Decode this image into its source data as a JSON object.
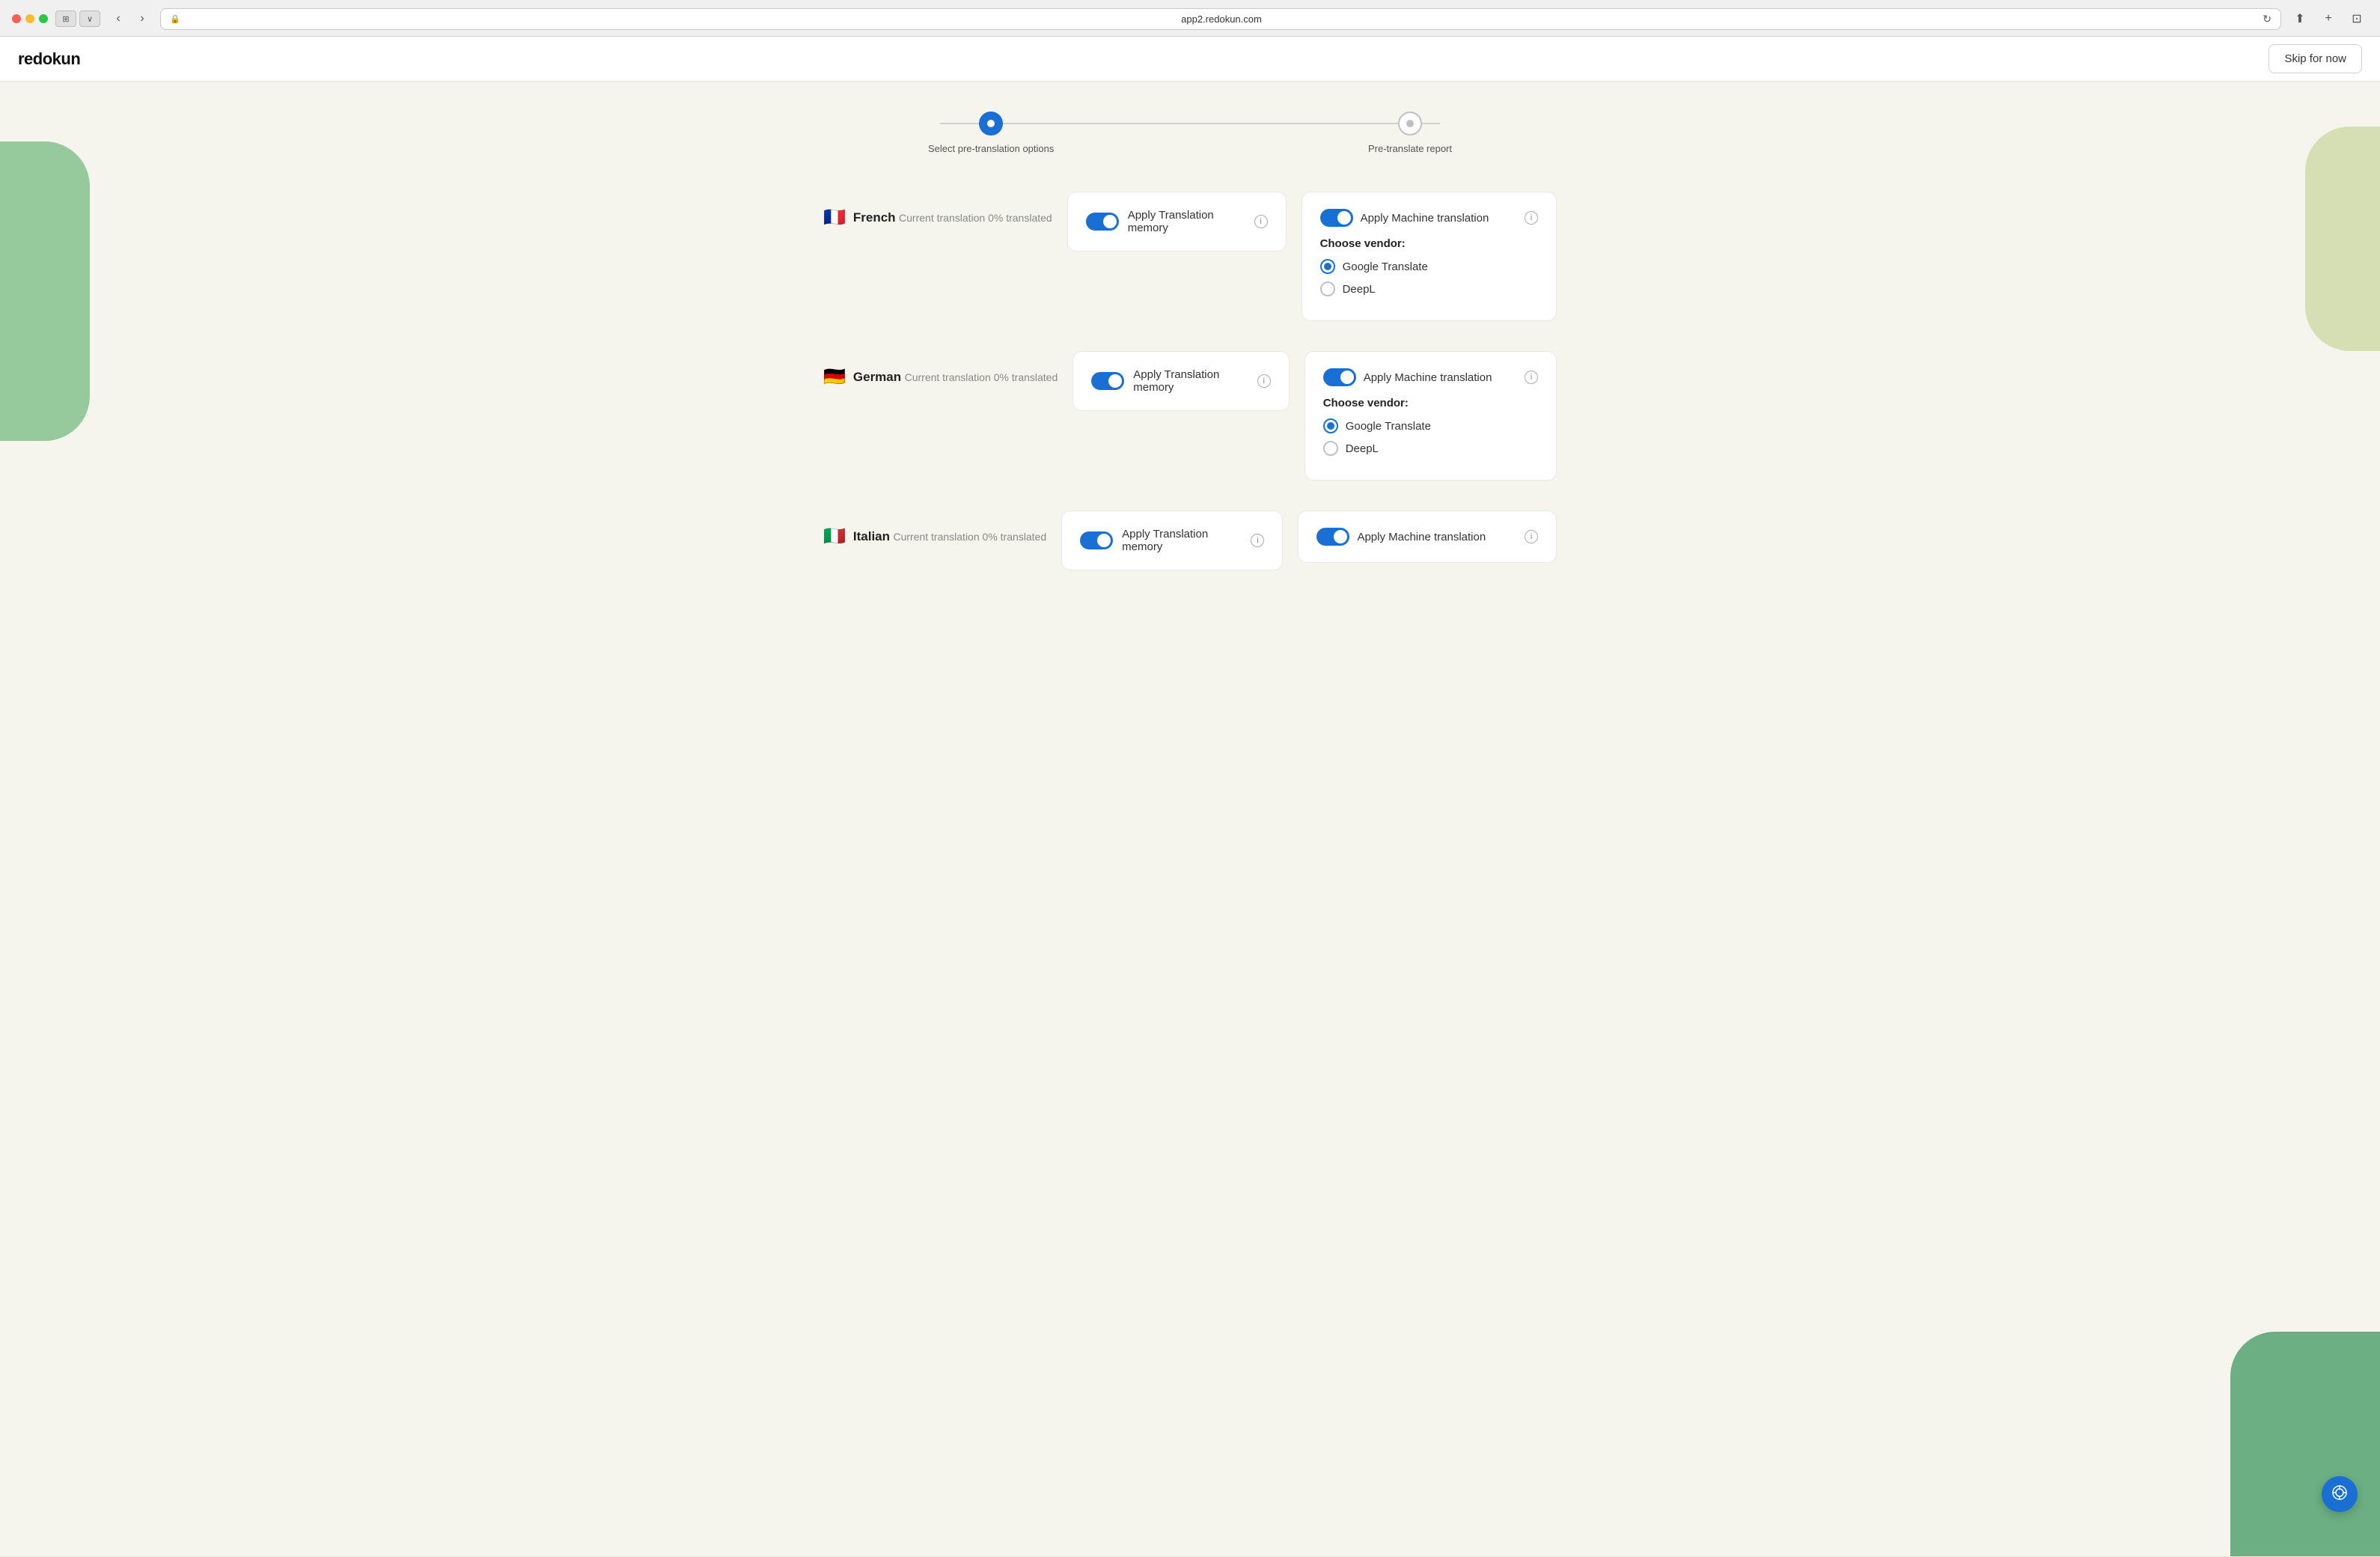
{
  "browser": {
    "url": "app2.redokun.com",
    "traffic_lights": [
      "red",
      "yellow",
      "green"
    ]
  },
  "header": {
    "logo": "redokun",
    "skip_button": "Skip for now"
  },
  "stepper": {
    "steps": [
      {
        "id": "step1",
        "label": "Select pre-translation options",
        "state": "active"
      },
      {
        "id": "step2",
        "label": "Pre-translate report",
        "state": "inactive"
      }
    ]
  },
  "languages": [
    {
      "id": "french",
      "flag": "🇫🇷",
      "name": "French",
      "status": "Current translation 0% translated",
      "translation_memory": {
        "toggle_on": true,
        "label": "Apply Translation memory",
        "info_label": "i"
      },
      "machine_translation": {
        "toggle_on": true,
        "label": "Apply Machine translation",
        "info_label": "i",
        "choose_vendor_label": "Choose vendor:",
        "vendors": [
          {
            "id": "google",
            "label": "Google Translate",
            "selected": true
          },
          {
            "id": "deepl",
            "label": "DeepL",
            "selected": false
          }
        ]
      }
    },
    {
      "id": "german",
      "flag": "🇩🇪",
      "name": "German",
      "status": "Current translation 0% translated",
      "translation_memory": {
        "toggle_on": true,
        "label": "Apply Translation memory",
        "info_label": "i"
      },
      "machine_translation": {
        "toggle_on": true,
        "label": "Apply Machine translation",
        "info_label": "i",
        "choose_vendor_label": "Choose vendor:",
        "vendors": [
          {
            "id": "google",
            "label": "Google Translate",
            "selected": true
          },
          {
            "id": "deepl",
            "label": "DeepL",
            "selected": false
          }
        ]
      }
    },
    {
      "id": "italian",
      "flag": "🇮🇹",
      "name": "Italian",
      "status": "Current translation 0% translated",
      "translation_memory": {
        "toggle_on": true,
        "label": "Apply Translation memory",
        "info_label": "i"
      },
      "machine_translation": {
        "toggle_on": true,
        "label": "Apply Machine translation",
        "info_label": "i"
      }
    }
  ],
  "help_button": {
    "icon": "⊕",
    "label": "Help"
  },
  "colors": {
    "primary": "#1a6fd4",
    "background": "#f5f5ed",
    "card_bg": "#ffffff",
    "border": "#e8e8e8"
  }
}
